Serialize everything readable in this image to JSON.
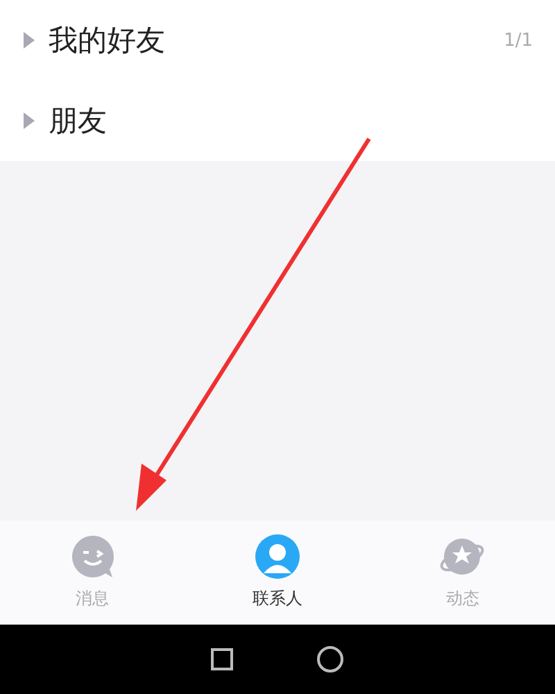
{
  "groups": [
    {
      "name": "我的好友",
      "count": "1/1",
      "expanded": false
    },
    {
      "name": "朋友",
      "expanded": false
    }
  ],
  "tabs": [
    {
      "label": "消息",
      "selected": false,
      "kind": "chat"
    },
    {
      "label": "联系人",
      "selected": true,
      "kind": "contact"
    },
    {
      "label": "动态",
      "selected": false,
      "kind": "planet"
    }
  ],
  "annotation": {
    "kind": "arrow"
  }
}
